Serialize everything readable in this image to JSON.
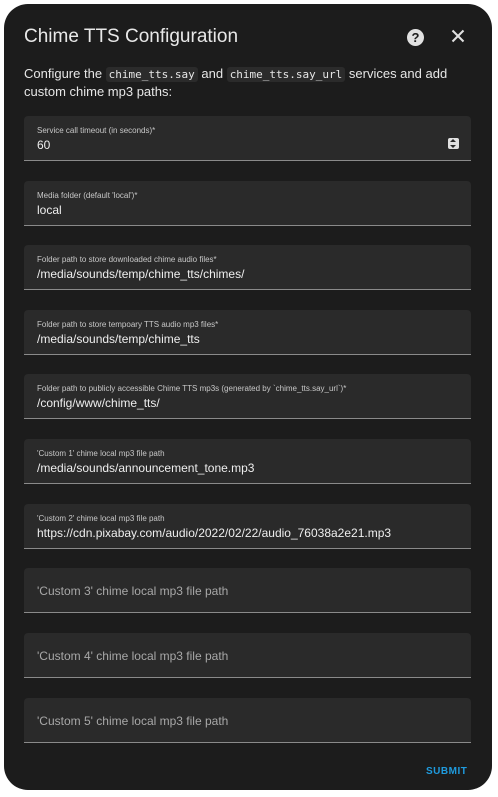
{
  "dialog": {
    "title": "Chime TTS Configuration",
    "description_part1": "Configure the ",
    "code_say": "chime_tts.say",
    "description_part2": " and ",
    "code_say_url": "chime_tts.say_url",
    "description_part3": " services and add custom chime mp3 paths:",
    "submit_label": "SUBMIT",
    "icons": {
      "help": "help-circle-icon",
      "close": "close-icon"
    },
    "help_glyph": "?",
    "accent_color": "#1f9bde"
  },
  "fields": [
    {
      "label": "Service call timeout (in seconds)*",
      "value": "60"
    },
    {
      "label": "Media folder (default 'local')*",
      "value": "local"
    },
    {
      "label": "Folder path to store downloaded chime audio files*",
      "value": "/media/sounds/temp/chime_tts/chimes/"
    },
    {
      "label": "Folder path to store tempoary TTS audio mp3 files*",
      "value": "/media/sounds/temp/chime_tts"
    },
    {
      "label": "Folder path to publicly accessible Chime TTS mp3s (generated by `chime_tts.say_url`)*",
      "value": "/config/www/chime_tts/"
    },
    {
      "label": "'Custom 1' chime local mp3 file path",
      "value": "/media/sounds/announcement_tone.mp3"
    },
    {
      "label": "'Custom 2' chime local mp3 file path",
      "value": "https://cdn.pixabay.com/audio/2022/02/22/audio_76038a2e21.mp3"
    },
    {
      "placeholder": "'Custom 3' chime local mp3 file path"
    },
    {
      "placeholder": "'Custom 4' chime local mp3 file path"
    },
    {
      "placeholder": "'Custom 5' chime local mp3 file path"
    }
  ]
}
